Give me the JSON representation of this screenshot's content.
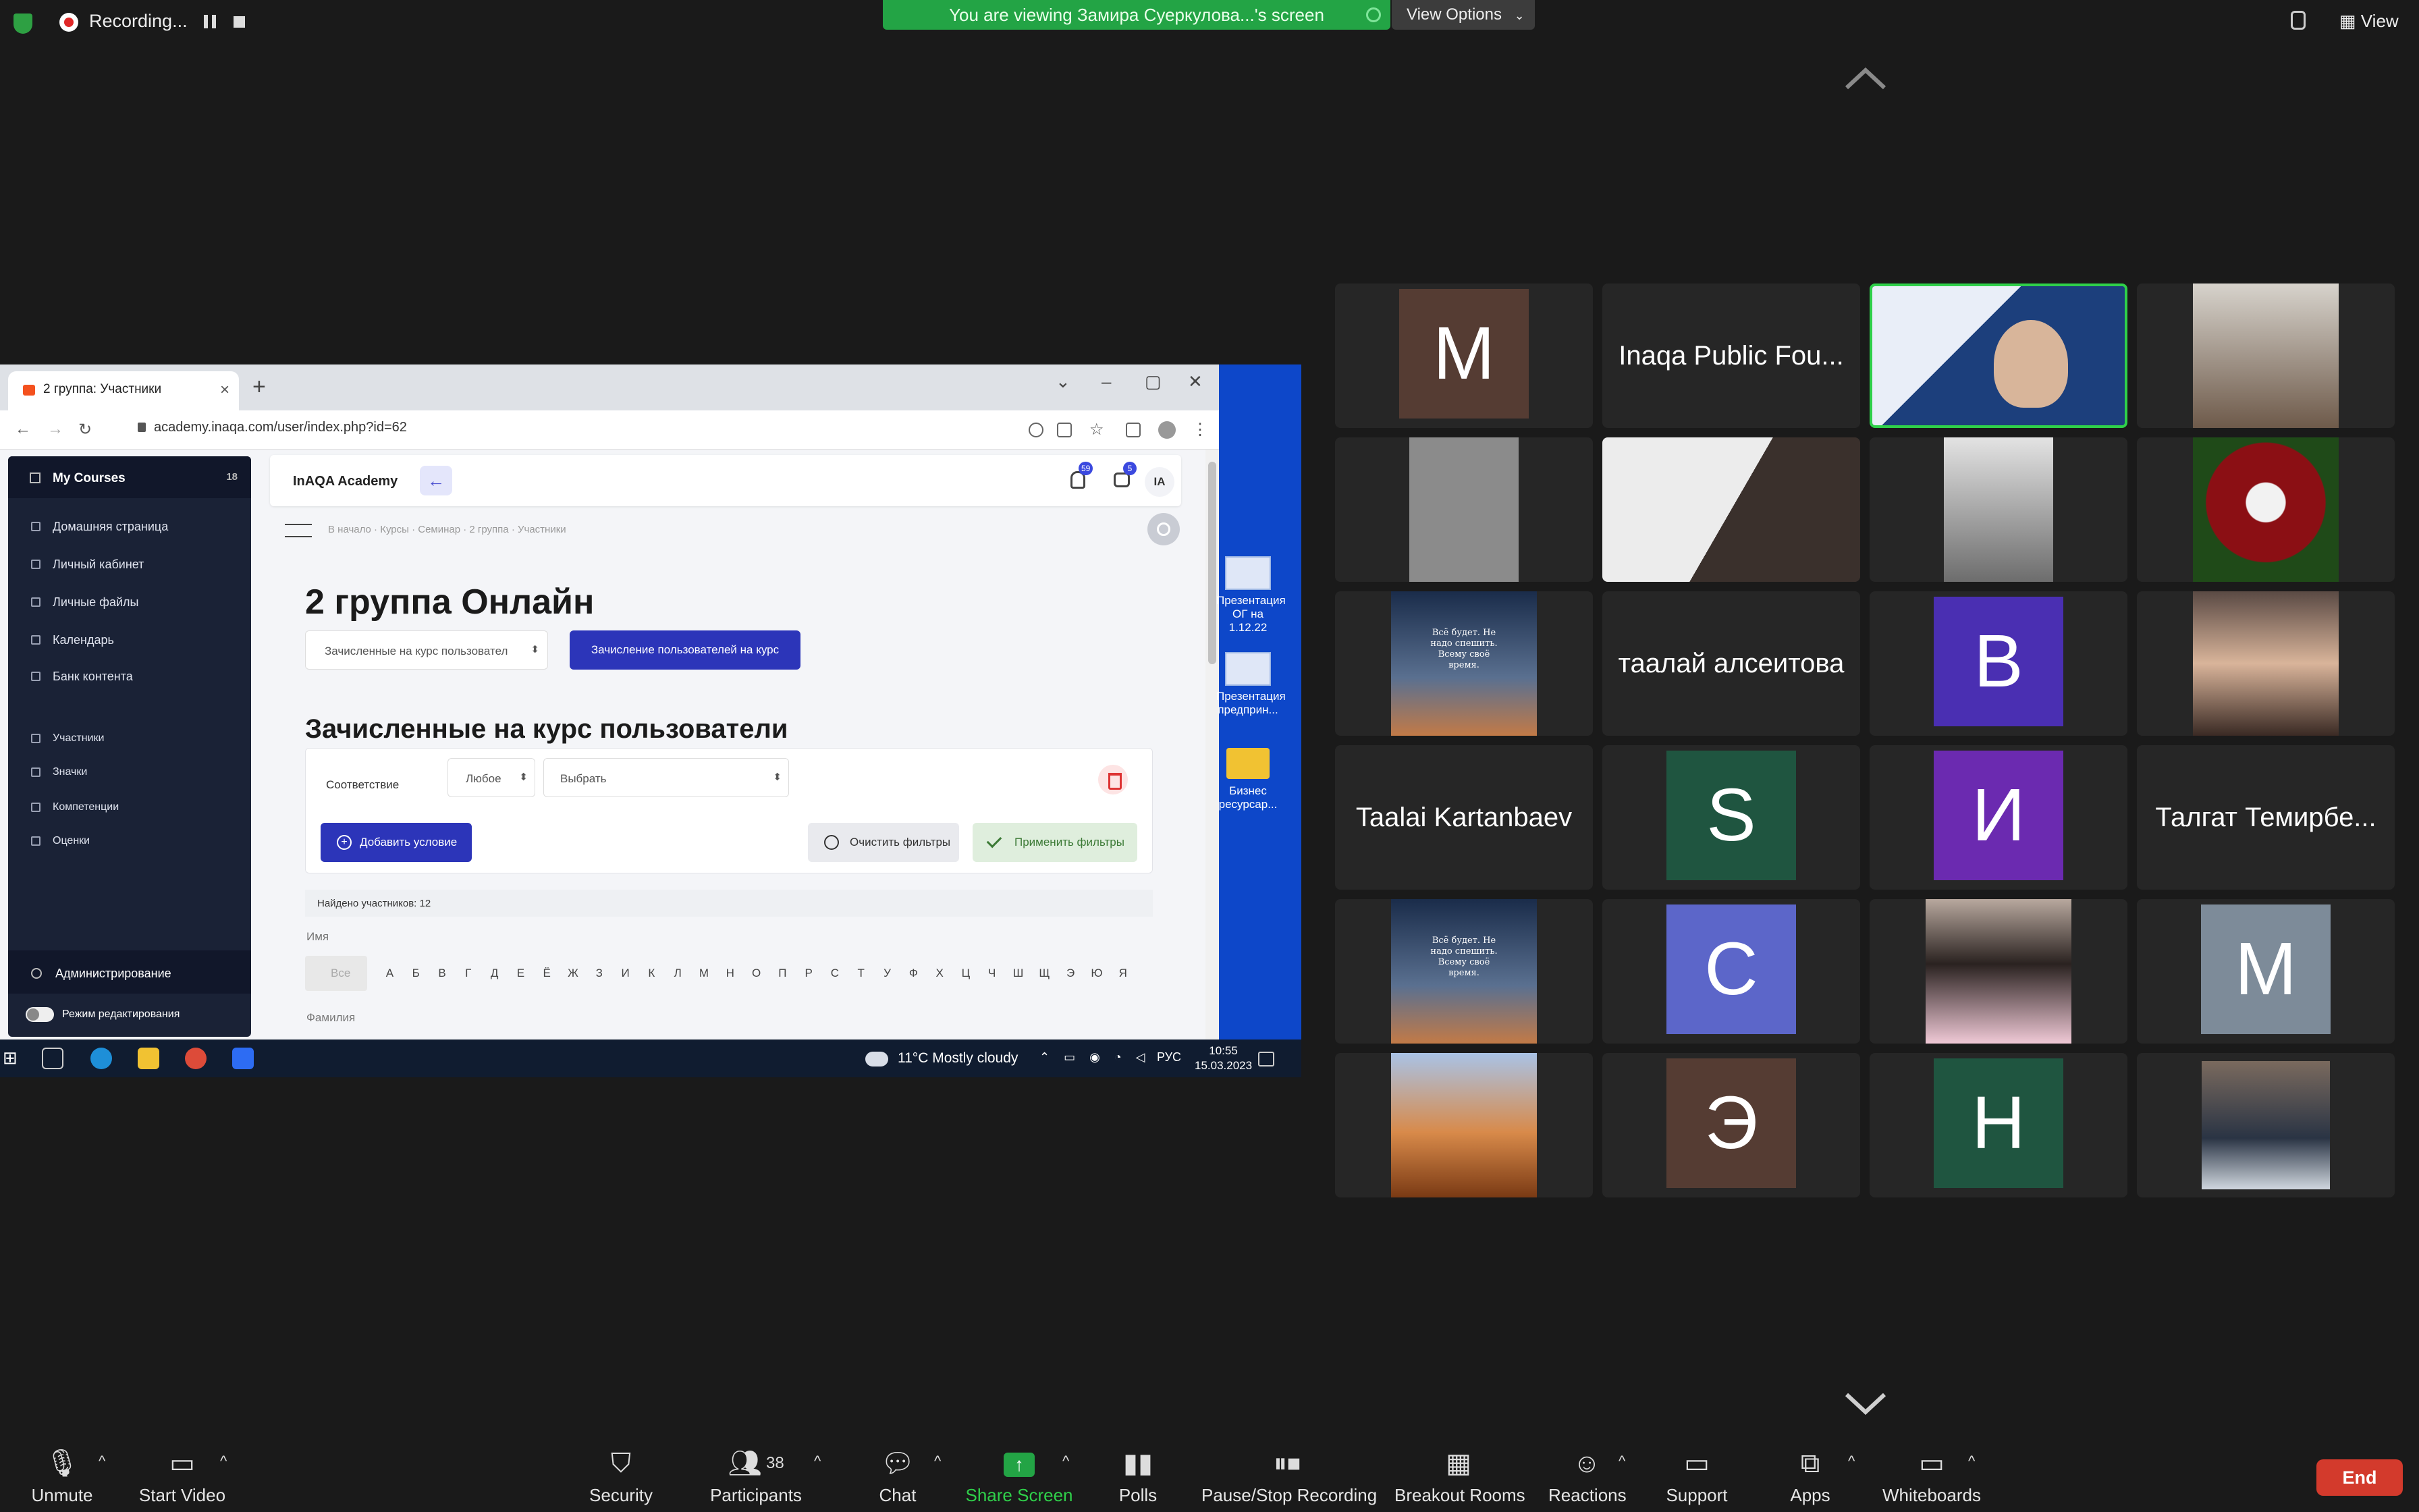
{
  "topbar": {
    "recording": "Recording...",
    "viewing_banner": "You are viewing Замира Суеркулова...'s screen",
    "view_options": "View Options",
    "view": "View"
  },
  "browser": {
    "tab_title": "2 группа: Участники",
    "url": "academy.inaqa.com/user/index.php?id=62"
  },
  "lms": {
    "sidebar_title": "My Courses",
    "sidebar_badge": "18",
    "nav": [
      "Домашняя страница",
      "Личный кабинет",
      "Личные файлы",
      "Календарь",
      "Банк контента"
    ],
    "course_nav": [
      "Участники",
      "Значки",
      "Компетенции",
      "Оценки"
    ],
    "admin": "Администрирование",
    "edit_mode": "Режим редактирования",
    "brand": "InAQA Academy",
    "notif_count": "59",
    "msg_count": "5",
    "user_initials": "IA",
    "breadcrumb": "В начало · Курсы · Семинар · 2 группа · Участники",
    "page_title": "2 группа Онлайн",
    "enrolled_select": "Зачисленные на курс пользовател",
    "enroll_button": "Зачисление пользователей на курс",
    "section_title": "Зачисленные на курс пользователи",
    "filter_match": "Соответствие",
    "filter_any": "Любое",
    "filter_pick": "Выбрать",
    "add_condition": "Добавить условие",
    "clear_filters": "Очистить фильтры",
    "apply_filters": "Применить фильтры",
    "found": "Найдено участников: 12",
    "name_label": "Имя",
    "all_label": "Все",
    "letters": [
      "А",
      "Б",
      "В",
      "Г",
      "Д",
      "Е",
      "Ё",
      "Ж",
      "З",
      "И",
      "К",
      "Л",
      "М",
      "Н",
      "О",
      "П",
      "Р",
      "С",
      "Т",
      "У",
      "Ф",
      "Х",
      "Ц",
      "Ч",
      "Ш",
      "Щ",
      "Э",
      "Ю",
      "Я"
    ],
    "surname_label": "Фамилия"
  },
  "desktop_icons": [
    "Презентация ОГ на 1.12.22",
    "Презентация предприн...",
    "Бизнес ресурсар..."
  ],
  "taskbar": {
    "weather": "11°C  Mostly cloudy",
    "lang": "РУС",
    "time": "10:55",
    "date": "15.03.2023"
  },
  "gallery": {
    "letters": [
      "M",
      "B",
      "S",
      "И",
      "C",
      "M",
      "Э",
      "H"
    ],
    "names": [
      "Inaqa Public Fou...",
      "таалай алсеитова",
      "Taalai Kartanbaev",
      "Талгат Темирбе..."
    ],
    "image_caption": "Всё будет. Не надо спешить. Всему своё время."
  },
  "toolbar": {
    "unmute": "Unmute",
    "start_video": "Start Video",
    "security": "Security",
    "participants": "Participants",
    "participants_count": "38",
    "chat": "Chat",
    "share_screen": "Share Screen",
    "polls": "Polls",
    "pause_stop": "Pause/Stop Recording",
    "breakout": "Breakout Rooms",
    "reactions": "Reactions",
    "support": "Support",
    "apps": "Apps",
    "whiteboards": "Whiteboards",
    "end": "End"
  },
  "colors": {
    "zoom_bg": "#1a1a1a",
    "active_speaker": "#2fd04a",
    "end_button": "#d33a2c",
    "lms_primary": "#2c35b9",
    "share_green": "#23a445"
  }
}
